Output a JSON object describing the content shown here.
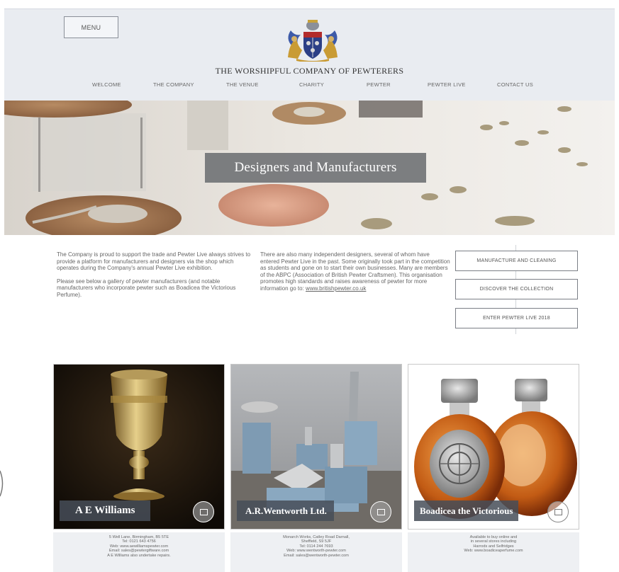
{
  "header": {
    "menu_label": "MENU",
    "org_name": "THE WORSHIPFUL COMPANY OF PEWTERERS",
    "nav": [
      "WELCOME",
      "THE COMPANY",
      "THE VENUE",
      "CHARITY",
      "PEWTER",
      "PEWTER LIVE",
      "CONTACT US"
    ]
  },
  "hero": {
    "title": "Designers and Manufacturers"
  },
  "intro": {
    "col1_p1": "The Company is proud to support the trade and Pewter Live always strives to provide a platform for manufacturers and designers via the shop which operates during the Company's annual Pewter Live exhibition.",
    "col1_p2": "Please see below a gallery of pewter manufacturers (and notable manufacturers who incorporate pewter such as Boadicea the Victorious Perfume).",
    "col2_text": "There are also many independent designers, several of whom have entered Pewter Live in the past. Some originally took part in the competition as students and gone on to start their own businesses.  Many are members of the ABPC (Association of British Pewter Craftsmen). This organisation promotes high standards and raises awareness of pewter for more information go to:",
    "col2_link": "www.britishpewter.co.uk"
  },
  "side_buttons": [
    "MANUFACTURE AND CLEANING",
    "DISCOVER THE COLLECTION",
    "ENTER PEWTER LIVE 2018"
  ],
  "cards": [
    {
      "title": "A E Williams",
      "info": [
        "5 Well Lane, Birmingham, B5 5TE",
        "Tel: 0121 643 4756",
        "Web: www.aewilliamspewter.com",
        "Email: sales@pewtergiftware.com",
        "A E Williams also undertake repairs."
      ]
    },
    {
      "title": "A.R.Wentworth Ltd.",
      "info": [
        "Monarch Works, Catley Road Darnall,",
        "Sheffield, S9 5JF",
        "Tel: 0114 244 7693",
        "Web: www.wentworth-pewter.com",
        "Email: sales@wentworth-pewter.com"
      ]
    },
    {
      "title": "Boadicea the Victorious",
      "info": [
        "Available to buy online and",
        "in several stores including",
        "Harrods and Selfridges",
        "Web: www.boadiceaperfume.com"
      ]
    }
  ],
  "icons": {
    "crest": "coat-of-arms-icon",
    "card_button": "chevron-square-icon"
  }
}
